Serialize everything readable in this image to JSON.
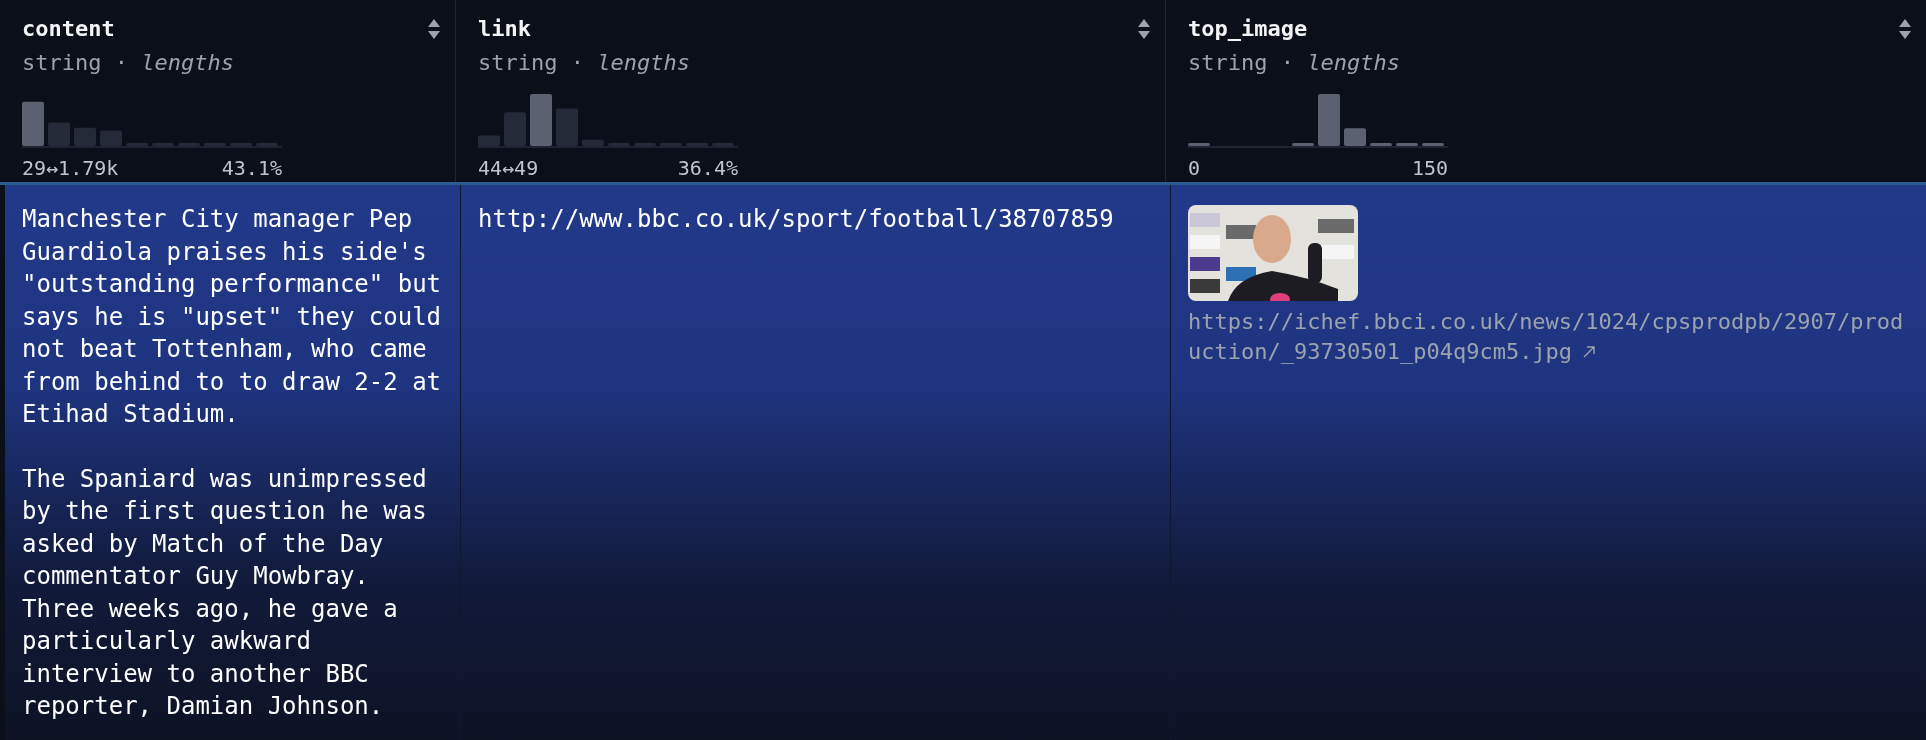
{
  "table": {
    "columns": [
      {
        "name": "content",
        "type": "string · *lengths*",
        "range_min": "29↔1.79k",
        "range_max": "43.1%"
      },
      {
        "name": "link",
        "type": "string · *lengths*",
        "range_min": "44↔49",
        "range_max": "36.4%"
      },
      {
        "name": "top_image",
        "type": "string · *lengths*",
        "range_min": "0",
        "range_max": "150"
      }
    ],
    "rows": [
      {
        "content": [
          "Manchester City manager Pep Guardiola praises his side's \"outstanding performance\" but says he is \"upset\" they could not beat Tottenham, who came from behind to to draw 2-2 at Etihad Stadium.",
          "The Spaniard was unimpressed by the first question he was asked by Match of the Day commentator Guy Mowbray. Three weeks ago, he gave a particularly awkward interview to another BBC reporter, Damian Johnson."
        ],
        "link": "http://www.bbc.co.uk/sport/football/38707859",
        "top_image": {
          "kind": "picture",
          "url": "https://ichef.bbci.co.uk/news/1024/cpsprodpb/2907/production/_93730501_p04q9cm5.jpg"
        }
      }
    ]
  }
}
